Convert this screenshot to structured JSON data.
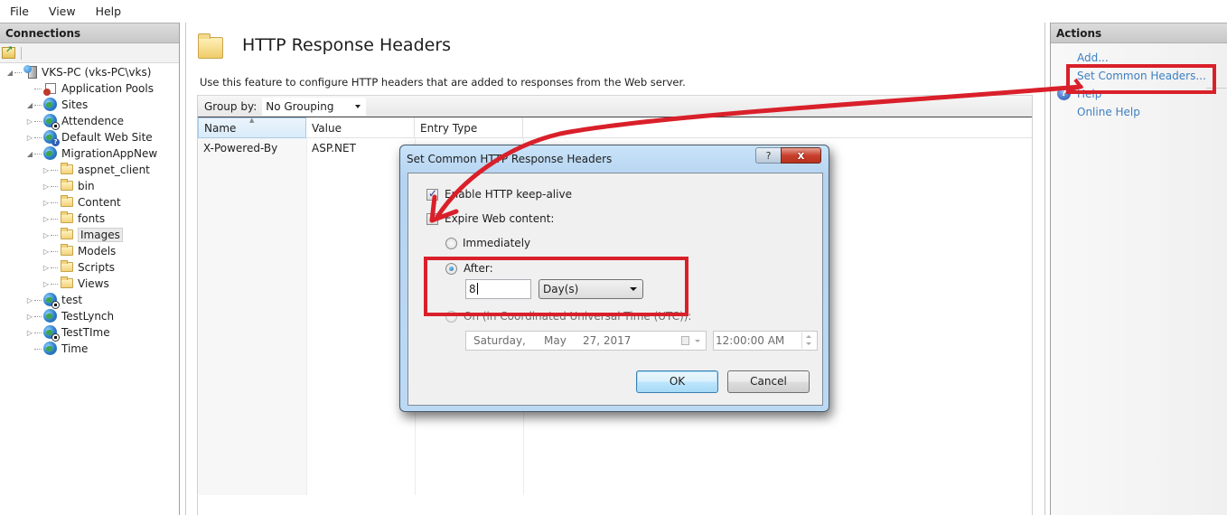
{
  "menubar": {
    "items": [
      "File",
      "View",
      "Help"
    ]
  },
  "connections": {
    "title": "Connections",
    "tree": [
      {
        "label": "VKS-PC (vks-PC\\vks)",
        "icon": "server-icon",
        "level": 0,
        "expander": "expanded"
      },
      {
        "label": "Application Pools",
        "icon": "app-pool-icon",
        "level": 1,
        "expander": "none"
      },
      {
        "label": "Sites",
        "icon": "sites-folder-icon",
        "level": 1,
        "expander": "expanded"
      },
      {
        "label": "Attendence",
        "icon": "site-stopped-icon",
        "level": 2,
        "expander": "collapsed"
      },
      {
        "label": "Default Web Site",
        "icon": "site-unknown-icon",
        "level": 2,
        "expander": "collapsed"
      },
      {
        "label": "MigrationAppNew",
        "icon": "site-icon",
        "level": 2,
        "expander": "expanded"
      },
      {
        "label": "aspnet_client",
        "icon": "folder-icon",
        "level": 3,
        "expander": "collapsed"
      },
      {
        "label": "bin",
        "icon": "folder-icon",
        "level": 3,
        "expander": "collapsed"
      },
      {
        "label": "Content",
        "icon": "folder-icon",
        "level": 3,
        "expander": "collapsed"
      },
      {
        "label": "fonts",
        "icon": "folder-icon",
        "level": 3,
        "expander": "collapsed"
      },
      {
        "label": "Images",
        "icon": "folder-icon",
        "level": 3,
        "expander": "collapsed",
        "selected": true
      },
      {
        "label": "Models",
        "icon": "folder-icon",
        "level": 3,
        "expander": "collapsed"
      },
      {
        "label": "Scripts",
        "icon": "folder-icon",
        "level": 3,
        "expander": "collapsed"
      },
      {
        "label": "Views",
        "icon": "folder-icon",
        "level": 3,
        "expander": "collapsed"
      },
      {
        "label": "test",
        "icon": "site-stopped-icon",
        "level": 2,
        "expander": "collapsed"
      },
      {
        "label": "TestLynch",
        "icon": "site-icon",
        "level": 2,
        "expander": "collapsed"
      },
      {
        "label": "TestTIme",
        "icon": "site-stopped-icon",
        "level": 2,
        "expander": "collapsed"
      },
      {
        "label": "Time",
        "icon": "site-icon",
        "level": 2,
        "expander": "none"
      }
    ]
  },
  "content": {
    "title": "HTTP Response Headers",
    "description": "Use this feature to configure HTTP headers that are added to responses from the Web server.",
    "group_by_label": "Group by:",
    "group_by_value": "No Grouping",
    "columns": [
      "Name",
      "Value",
      "Entry Type"
    ],
    "rows": [
      {
        "name": "X-Powered-By",
        "value": "ASP.NET",
        "entry_type": ""
      }
    ]
  },
  "actions": {
    "title": "Actions",
    "items": [
      {
        "label": "Add...",
        "icon": null
      },
      {
        "label": "Set Common Headers...",
        "icon": null
      },
      {
        "label": "Help",
        "icon": "help-icon"
      },
      {
        "label": "Online Help",
        "icon": null
      }
    ]
  },
  "dialog": {
    "title": "Set Common HTTP Response Headers",
    "help_button": "?",
    "close_button": "x",
    "keep_alive_label": "Enable HTTP keep-alive",
    "keep_alive_checked": true,
    "expire_label": "Expire Web content:",
    "expire_checked": true,
    "immediately_label": "Immediately",
    "after_label": "After:",
    "on_label": "On (in Coordinated Universal Time (UTC)):",
    "selected_option": "after",
    "after_value": "8",
    "after_unit": "Day(s)",
    "date": {
      "weekday": "Saturday",
      "sep": ",",
      "month": "May",
      "day_year": "27, 2017"
    },
    "time": "12:00:00 AM",
    "ok_label": "OK",
    "cancel_label": "Cancel"
  },
  "annotation": {
    "color": "#d9202a"
  }
}
